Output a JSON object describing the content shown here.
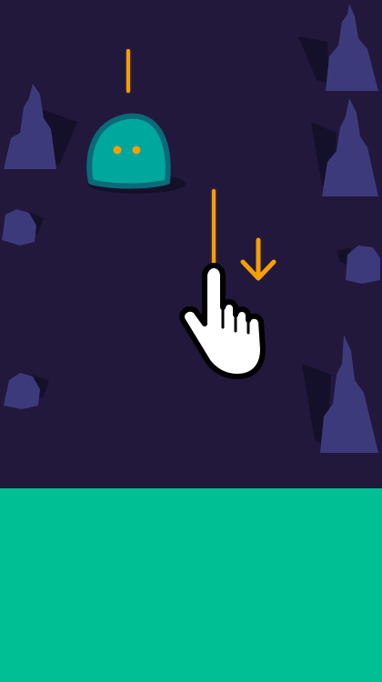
{
  "game": {
    "palette": {
      "background": "#21183c",
      "rock_fill": "#3d3a7c",
      "rock_shadow": "#15102a",
      "ground": "#00bf94",
      "laser": "#f5a000",
      "slime_body": "#00a79d",
      "slime_outline": "#0a6a77",
      "slime_eyes": "#f5a000",
      "hint_hand": "#ffffff",
      "hint_arrow": "#f5a000"
    },
    "icons": {
      "tutorial_hand": "pointing-hand-icon",
      "tutorial_arrow": "arrow-down-icon",
      "player": "slime-character"
    }
  }
}
